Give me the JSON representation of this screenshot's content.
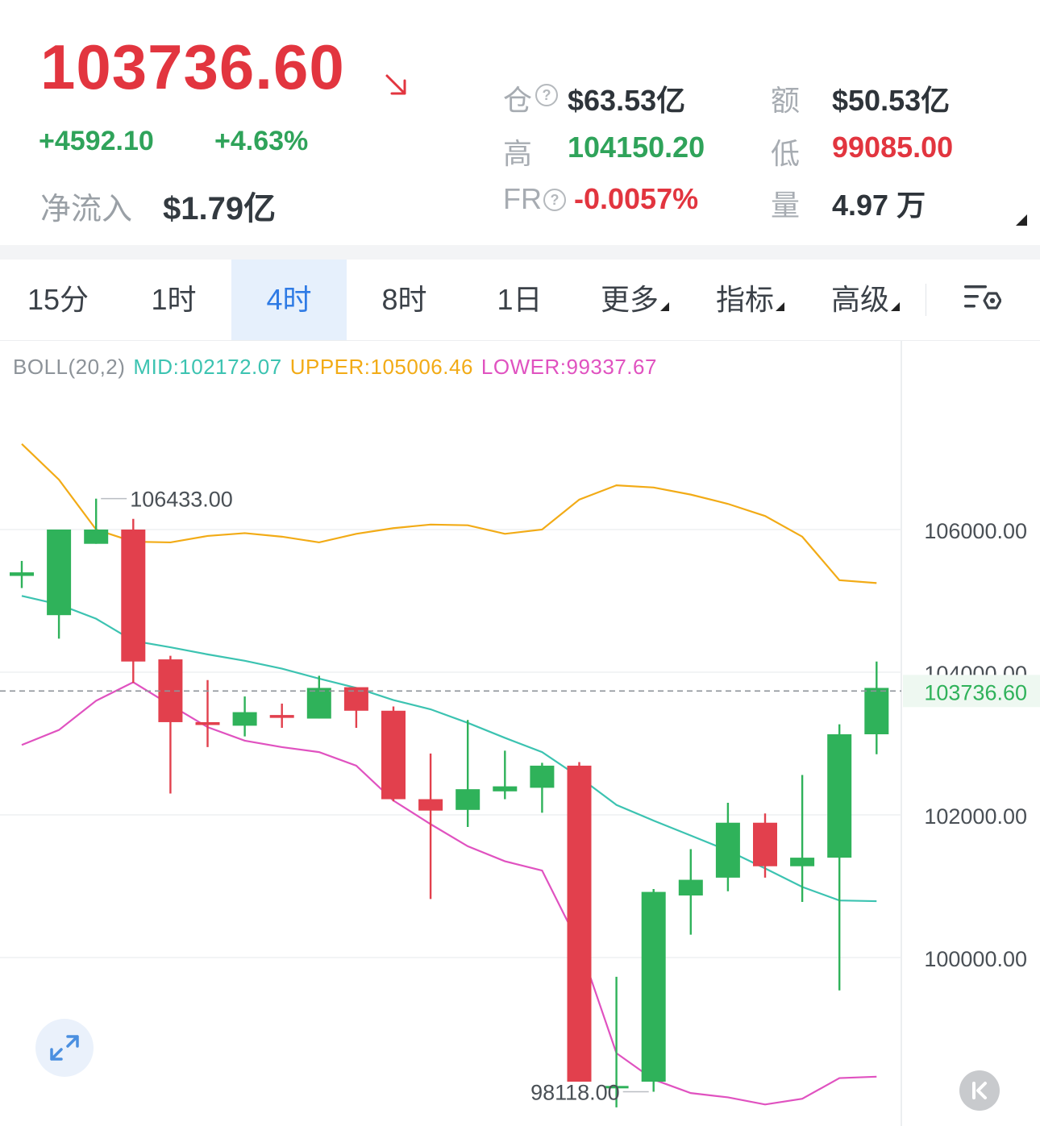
{
  "ticker": {
    "price": "103736.60",
    "change": "+4592.10",
    "change_pct": "+4.63%",
    "net_inflow_label": "净流入",
    "net_inflow": "$1.79亿"
  },
  "stats": {
    "open_interest_label": "仓",
    "open_interest": "$63.53亿",
    "turnover_label": "额",
    "turnover": "$50.53亿",
    "high_label": "高",
    "high": "104150.20",
    "low_label": "低",
    "low": "99085.00",
    "fr_label": "FR",
    "fr": "-0.0057%",
    "volume_label": "量",
    "volume": "4.97 万",
    "help_glyph": "?"
  },
  "tabs": [
    {
      "label": "15分"
    },
    {
      "label": "1时"
    },
    {
      "label": "4时",
      "active": true
    },
    {
      "label": "8时"
    },
    {
      "label": "1日"
    },
    {
      "label": "更多"
    },
    {
      "label": "指标"
    },
    {
      "label": "高级"
    }
  ],
  "indicator": {
    "name": "BOLL(20,2)",
    "mid": "MID:102172.07",
    "upper": "UPPER:105006.46",
    "lower": "LOWER:99337.67"
  },
  "colors": {
    "up": "#2fb25a",
    "down": "#e2404d",
    "mid": "#3cc3b1",
    "upper": "#f2ab16",
    "lower": "#e052c0",
    "accent": "#2f7be5"
  },
  "icons": {
    "trend": "arrow-down-right-icon",
    "settings": "chart-settings-icon",
    "expand": "expand-icon",
    "back": "jump-to-latest-icon"
  },
  "chart_data": {
    "type": "candlestick",
    "y_ticks": [
      "106000.00",
      "104000.00",
      "102000.00",
      "100000.00"
    ],
    "y_tick_values": [
      106000,
      104000,
      102000,
      100000
    ],
    "ylim": [
      97700,
      107500
    ],
    "current_price": 103736.6,
    "current_price_label": "103736.60",
    "max_annotation": {
      "label": "106433.00",
      "value": 106433,
      "index": 2
    },
    "min_annotation": {
      "label": "98118.00",
      "value": 98118,
      "index": 17
    },
    "candles": [
      {
        "o": 105350,
        "h": 105560,
        "l": 105180,
        "c": 105400
      },
      {
        "o": 104800,
        "h": 106000,
        "l": 104470,
        "c": 106000
      },
      {
        "o": 105800,
        "h": 106433,
        "l": 105800,
        "c": 106000
      },
      {
        "o": 106000,
        "h": 106150,
        "l": 103850,
        "c": 104150
      },
      {
        "o": 104180,
        "h": 104230,
        "l": 102300,
        "c": 103300
      },
      {
        "o": 103300,
        "h": 103890,
        "l": 102950,
        "c": 103260
      },
      {
        "o": 103250,
        "h": 103660,
        "l": 103100,
        "c": 103440
      },
      {
        "o": 103400,
        "h": 103560,
        "l": 103220,
        "c": 103360
      },
      {
        "o": 103350,
        "h": 103950,
        "l": 103350,
        "c": 103780
      },
      {
        "o": 103790,
        "h": 103790,
        "l": 103220,
        "c": 103460
      },
      {
        "o": 103460,
        "h": 103520,
        "l": 102190,
        "c": 102220
      },
      {
        "o": 102220,
        "h": 102860,
        "l": 100820,
        "c": 102060
      },
      {
        "o": 102070,
        "h": 103330,
        "l": 101830,
        "c": 102360
      },
      {
        "o": 102330,
        "h": 102900,
        "l": 102220,
        "c": 102400
      },
      {
        "o": 102380,
        "h": 102730,
        "l": 102030,
        "c": 102690
      },
      {
        "o": 102690,
        "h": 102740,
        "l": 98260,
        "c": 98260
      },
      {
        "o": 98200,
        "h": 99730,
        "l": 97900,
        "c": 98200
      },
      {
        "o": 98260,
        "h": 100960,
        "l": 98118,
        "c": 100920
      },
      {
        "o": 100870,
        "h": 101520,
        "l": 100320,
        "c": 101090
      },
      {
        "o": 101120,
        "h": 102170,
        "l": 100930,
        "c": 101890
      },
      {
        "o": 101890,
        "h": 102020,
        "l": 101120,
        "c": 101280
      },
      {
        "o": 101280,
        "h": 102560,
        "l": 100780,
        "c": 101400
      },
      {
        "o": 101400,
        "h": 103270,
        "l": 99540,
        "c": 103130
      },
      {
        "o": 103130,
        "h": 104150,
        "l": 102850,
        "c": 103780
      }
    ],
    "boll_mid": [
      105070,
      104950,
      104750,
      104440,
      104350,
      104250,
      104160,
      104050,
      103910,
      103780,
      103610,
      103480,
      103290,
      103080,
      102880,
      102530,
      102140,
      101920,
      101710,
      101500,
      101250,
      100990,
      100800,
      100790
    ],
    "boll_upper": [
      107200,
      106700,
      106000,
      105830,
      105820,
      105910,
      105950,
      105900,
      105820,
      105940,
      106020,
      106070,
      106060,
      105940,
      106000,
      106420,
      106620,
      106590,
      106490,
      106360,
      106190,
      105900,
      105290,
      105250
    ],
    "boll_lower": [
      102980,
      103190,
      103600,
      103860,
      103540,
      103230,
      103040,
      102950,
      102880,
      102690,
      102200,
      101870,
      101560,
      101350,
      101220,
      100180,
      98660,
      98290,
      98100,
      98040,
      97940,
      98020,
      98310,
      98330
    ]
  }
}
